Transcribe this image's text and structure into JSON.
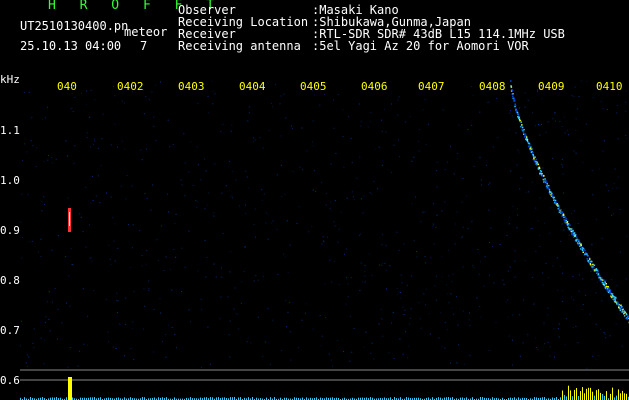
{
  "header": {
    "title": "H R O F F T",
    "file_name": "UT2510130400.pn",
    "mode_label": "meteor",
    "date_time": "25.10.13 04:00",
    "count": "7",
    "observer_label": "Observer",
    "observer_value": ":Masaki Kano",
    "location_label": "Receiving Location",
    "location_value": ":Shibukawa,Gunma,Japan",
    "receiver_label": "Receiver",
    "receiver_value": ":RTL-SDR SDR# 43dB L15 114.1MHz USB",
    "antenna_label": "Receiving antenna",
    "antenna_value": ":5el Yagi Az 20 for Aomori VOR"
  },
  "axes": {
    "unit": "kHz",
    "y_ticks": [
      "1.1",
      "1.0",
      "0.9",
      "0.8",
      "0.7",
      "0.6"
    ],
    "x_ticks": [
      "040",
      "0402",
      "0403",
      "0404",
      "0405",
      "0406",
      "0407",
      "0408",
      "0409",
      "0410"
    ]
  },
  "colors": {
    "background": "#000000",
    "header_title": "#33ff33",
    "tick_text": "#ffff00",
    "signal_core": "#ffffff",
    "signal_mid": "#33ccff",
    "signal_low": "#0044cc",
    "trace_strong": "#ffff00",
    "trace_cyan": "#33ccff"
  }
}
